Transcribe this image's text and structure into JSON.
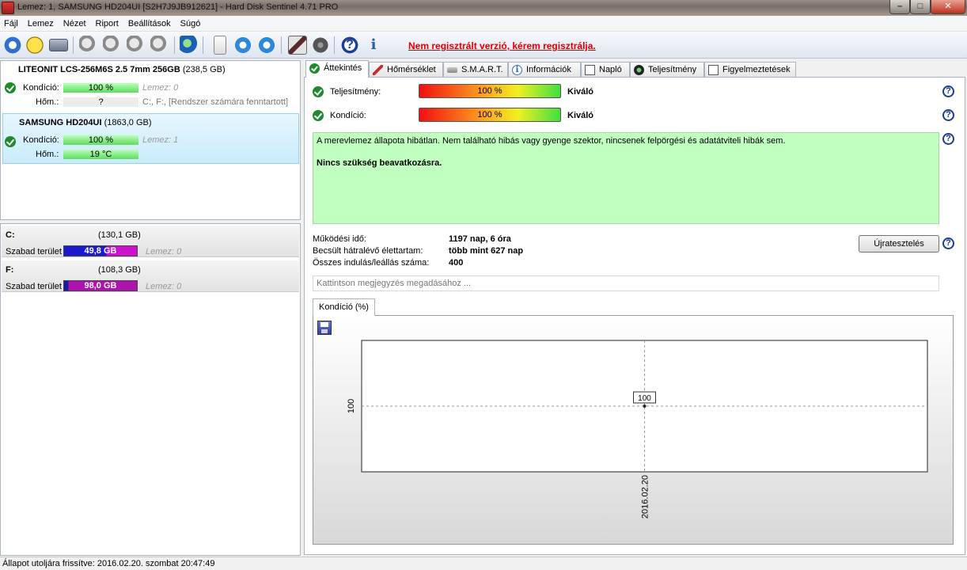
{
  "window": {
    "title": "Lemez: 1, SAMSUNG HD204UI [S2H7J9JB912621]  -  Hard Disk Sentinel 4.71 PRO"
  },
  "menu": [
    "Fájl",
    "Lemez",
    "Nézet",
    "Riport",
    "Beállítások",
    "Súgó"
  ],
  "toolbar": {
    "icons": [
      "refresh-icon",
      "warning-icon",
      "disk-icon",
      "tool-icon",
      "tool-icon",
      "tool-icon",
      "tool-icon",
      "globe-icon",
      "document-icon",
      "sync-icon",
      "network-icon",
      "chart-icon",
      "disc-icon",
      "help-icon",
      "info-icon"
    ],
    "help_glyph": "?",
    "info_glyph": "i",
    "register_text": "Nem regisztrált verzió, kérem regisztrálja."
  },
  "disks": [
    {
      "name_bold": "LITEONIT LCS-256M6S 2.5 7mm 256GB",
      "size": "(238,5 GB)",
      "condition_label": "Kondíció:",
      "condition_value": "100 %",
      "condition_note": "Lemez: 0",
      "temp_label": "Hőm.:",
      "temp_value": "?",
      "temp_note": "C:, F:,  [Rendszer számára fenntartott]"
    },
    {
      "name_bold": "SAMSUNG HD204UI",
      "size": "(1863,0 GB)",
      "condition_label": "Kondíció:",
      "condition_value": "100 %",
      "condition_note": "Lemez: 1",
      "temp_label": "Hőm.:",
      "temp_value": "19 °C"
    }
  ],
  "partitions": [
    {
      "letter": "C:",
      "size": "(130,1 GB)",
      "free_label": "Szabad terület",
      "free_value": "49,8 GB",
      "note": "Lemez: 0"
    },
    {
      "letter": "F:",
      "size": "(108,3 GB)",
      "free_label": "Szabad terület",
      "free_value": "98,0 GB",
      "note": "Lemez: 0"
    }
  ],
  "tabs": [
    {
      "label": "Áttekintés",
      "icon": "ok-icon"
    },
    {
      "label": "Hőmérséklet",
      "icon": "thermometer-icon"
    },
    {
      "label": "S.M.A.R.T.",
      "icon": "smart-icon"
    },
    {
      "label": "Információk",
      "icon": "info-icon"
    },
    {
      "label": "Napló",
      "icon": "log-icon"
    },
    {
      "label": "Teljesítmény",
      "icon": "performance-icon"
    },
    {
      "label": "Figyelmeztetések",
      "icon": "alert-icon"
    }
  ],
  "overview": {
    "performance_label": "Teljesítmény:",
    "performance_value": "100 %",
    "performance_verdict": "Kiváló",
    "condition_label": "Kondíció:",
    "condition_value": "100 %",
    "condition_verdict": "Kiváló",
    "status_message": "A merevlemez állapota hibátlan. Nem található hibás vagy gyenge szektor, nincsenek felpörgési és adatátviteli hibák sem.",
    "status_action": "Nincs szükség beavatkozásra.",
    "stats": [
      {
        "label": "Működési idő:",
        "value": "1197 nap, 6 óra"
      },
      {
        "label": "Becsült hátralévő élettartam:",
        "value": "több mint 627 nap"
      },
      {
        "label": "Összes indulás/leállás száma:",
        "value": "400"
      }
    ],
    "retest_button": "Újratesztelés",
    "note_placeholder": "Kattintson megjegyzés megadásához ...",
    "chart_tab": "Kondíció  (%)",
    "help_glyph": "?"
  },
  "chart_data": {
    "type": "line",
    "x": [
      "2016.02.20"
    ],
    "series": [
      {
        "values": [
          100
        ]
      }
    ],
    "ytick": "100",
    "data_label": "100"
  },
  "statusbar": {
    "text": "Állapot utoljára frissítve: 2016.02.20. szombat 20:47:49"
  }
}
